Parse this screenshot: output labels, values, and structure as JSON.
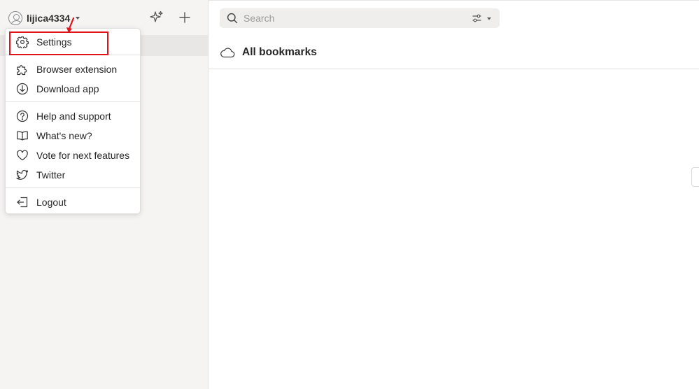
{
  "sidebar": {
    "username": "lijica4334"
  },
  "menu": {
    "items": [
      {
        "id": "settings",
        "label": "Settings",
        "icon": "gear-icon"
      },
      {
        "id": "browser-extension",
        "label": "Browser extension",
        "icon": "puzzle-icon"
      },
      {
        "id": "download-app",
        "label": "Download app",
        "icon": "download-icon"
      },
      {
        "id": "help",
        "label": "Help and support",
        "icon": "help-circle-icon"
      },
      {
        "id": "whats-new",
        "label": "What's new?",
        "icon": "book-icon"
      },
      {
        "id": "vote",
        "label": "Vote for next features",
        "icon": "heart-icon"
      },
      {
        "id": "twitter",
        "label": "Twitter",
        "icon": "twitter-icon"
      },
      {
        "id": "logout",
        "label": "Logout",
        "icon": "logout-icon"
      }
    ]
  },
  "search": {
    "placeholder": "Search"
  },
  "main": {
    "title": "All bookmarks"
  },
  "colors": {
    "highlight": "#e0141a",
    "sidebar_bg": "#f5f4f3",
    "search_bg": "#efeeed"
  }
}
